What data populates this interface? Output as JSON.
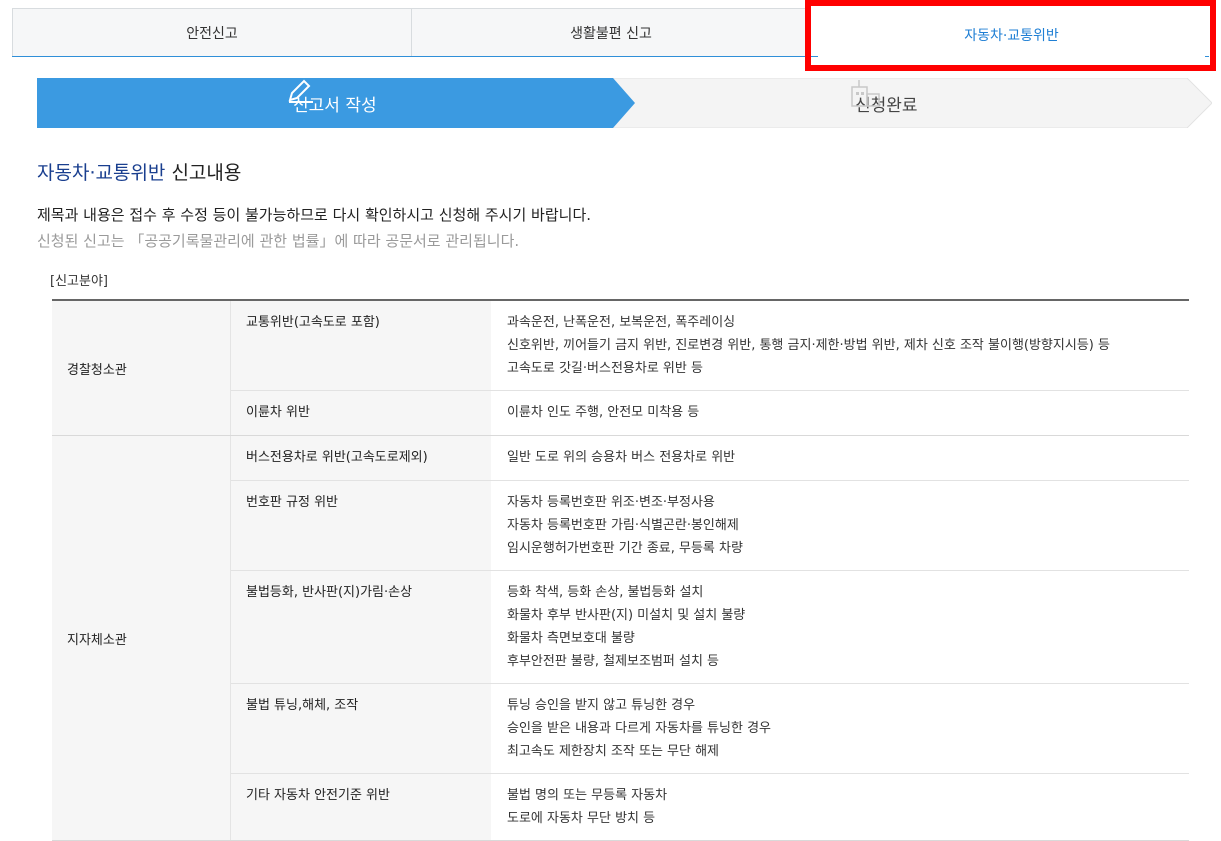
{
  "tabs": [
    {
      "label": "안전신고"
    },
    {
      "label": "생활불편 신고"
    },
    {
      "label": "자동차·교통위반"
    }
  ],
  "colors": {
    "accent": "#3b9ae1",
    "highlight": "#ff0000",
    "title_accent": "#1a3f8f"
  },
  "steps": [
    {
      "label": "신고서 작성",
      "icon": "pencil-icon"
    },
    {
      "label": "신청완료",
      "icon": "building-icon"
    }
  ],
  "heading": {
    "accent": "자동차·교통위반",
    "rest": " 신고내용"
  },
  "notice": {
    "line1": "제목과 내용은 접수 후 수정 등이 불가능하므로 다시 확인하시고 신청해 주시기 바랍니다.",
    "line2": "신청된 신고는 「공공기록물관리에 관한 법률」에 따라 공문서로 관리됩니다."
  },
  "field_label": "[신고분야]",
  "groups": [
    {
      "name": "경찰청소관",
      "rows": [
        {
          "name": "교통위반(고속도로 포함)",
          "desc": [
            "과속운전, 난폭운전, 보복운전, 폭주레이싱",
            "신호위반, 끼어들기 금지 위반, 진로변경 위반, 통행 금지·제한·방법 위반, 제차 신호 조작 불이행(방향지시등) 등",
            "고속도로 갓길·버스전용차로 위반 등"
          ]
        },
        {
          "name": "이륜차 위반",
          "desc": [
            "이륜차 인도 주행, 안전모 미착용 등"
          ]
        }
      ]
    },
    {
      "name": "지자체소관",
      "rows": [
        {
          "name": "버스전용차로 위반(고속도로제외)",
          "desc": [
            "일반 도로 위의 승용차 버스 전용차로 위반"
          ]
        },
        {
          "name": "번호판 규정 위반",
          "desc": [
            "자동차 등록번호판 위조·변조·부정사용",
            "자동차 등록번호판 가림·식별곤란·봉인해제",
            "임시운행허가번호판 기간 종료, 무등록 차량"
          ]
        },
        {
          "name": "불법등화, 반사판(지)가림·손상",
          "desc": [
            "등화 착색, 등화 손상, 불법등화 설치",
            "화물차 후부 반사판(지) 미설치 및 설치 불량",
            "화물차 측면보호대 불량",
            "후부안전판 불량, 철제보조범퍼 설치 등"
          ]
        },
        {
          "name": "불법 튜닝,해체, 조작",
          "desc": [
            "튜닝 승인을 받지 않고 튜닝한 경우",
            "승인을 받은 내용과 다르게 자동차를 튜닝한 경우",
            "최고속도 제한장치 조작 또는 무단 해제"
          ]
        },
        {
          "name": "기타 자동차 안전기준 위반",
          "desc": [
            "불법 명의 또는 무등록 자동차",
            "도로에 자동차 무단 방치 등"
          ]
        }
      ]
    }
  ]
}
